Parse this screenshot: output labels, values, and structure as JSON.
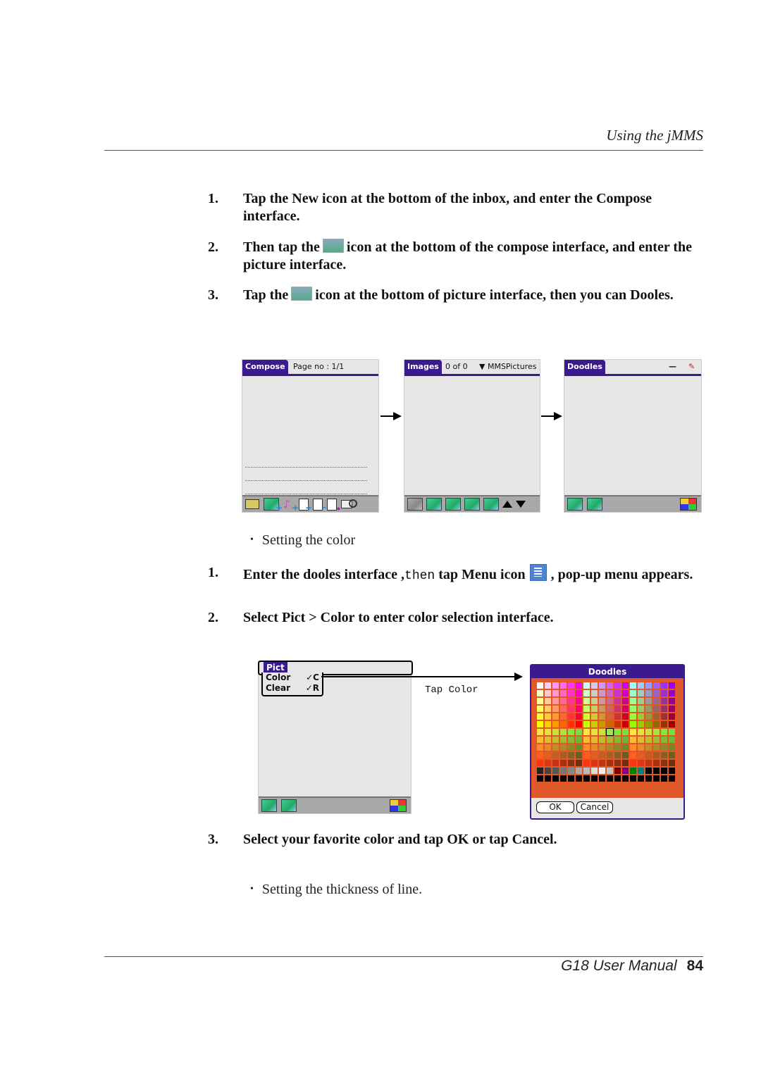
{
  "header": {
    "title": "Using the jMMS"
  },
  "steps_a": [
    {
      "num": "1.",
      "text": "Tap the New icon at the bottom of the inbox, and enter the Compose interface."
    },
    {
      "num": "2.",
      "before": "Then tap the",
      "after": "icon at the bottom of the compose interface, and enter the picture interface.",
      "icon": "add-picture-icon"
    },
    {
      "num": "3.",
      "before": "Tap the",
      "after": "icon at the bottom of picture interface, then you can Dooles.",
      "icon": "doodle-picture-icon"
    }
  ],
  "screens": {
    "compose": {
      "tab": "Compose",
      "info": "Page no : 1/1",
      "toolbar_icons": [
        "mail-icon",
        "add-picture-icon",
        "add-music-icon",
        "add-page-icon",
        "remove-page-icon",
        "page-timing-icon",
        "preview-icon"
      ]
    },
    "images": {
      "tab": "Images",
      "count": "0 of 0",
      "folder": "▼ MMSPictures",
      "toolbar_icons": [
        "select-icon",
        "new-picture-icon",
        "doodle-picture-icon",
        "delete-picture-icon",
        "picture-info-icon",
        "scroll-up-icon",
        "scroll-down-icon"
      ]
    },
    "doodles": {
      "tab": "Doodles",
      "line_label": "—",
      "toolbar_icons": [
        "save-picture-icon",
        "undo-picture-icon",
        "palette-brush-icon"
      ]
    }
  },
  "bullet1": "Setting the color",
  "steps_b": [
    {
      "num": "1.",
      "before": "Enter the dooles interface ,",
      "mono": "then",
      "middle": " tap Menu icon",
      "after": ", pop-up menu appears."
    },
    {
      "num": "2.",
      "text": "Select Pict > Color to enter color selection interface."
    }
  ],
  "pict_menu": {
    "title": "Pict",
    "items": [
      {
        "label": "Color",
        "shortcut": "✓C"
      },
      {
        "label": "Clear",
        "shortcut": "✓R"
      }
    ]
  },
  "tap_color_label": "Tap Color",
  "color_dialog": {
    "title": "Doodles",
    "ok": "OK",
    "cancel": "Cancel",
    "accent": "#3a1a8c",
    "background": "#e0582a"
  },
  "step3": {
    "num": "3.",
    "text": "Select your favorite color and tap OK or tap Cancel."
  },
  "bullet2": "Setting the thickness of line.",
  "footer": {
    "manual": "G18 User Manual",
    "page": "84"
  }
}
